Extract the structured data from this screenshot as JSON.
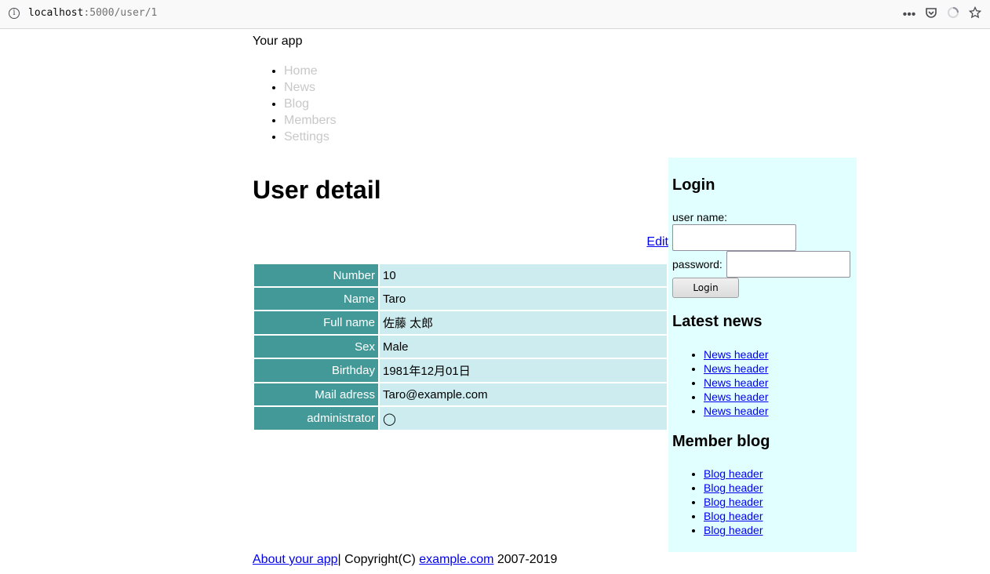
{
  "browser": {
    "host": "localhost",
    "path": ":5000/user/1",
    "icons": [
      "more-icon",
      "pocket-icon",
      "loading-icon",
      "bookmark-star-icon"
    ]
  },
  "brand": "Your app",
  "nav": [
    "Home",
    "News",
    "Blog",
    "Members",
    "Settings"
  ],
  "main": {
    "title": "User detail",
    "edit_label": "Edit",
    "rows": [
      {
        "label": "Number",
        "value": "10"
      },
      {
        "label": "Name",
        "value": "Taro"
      },
      {
        "label": "Full name",
        "value": "佐藤 太郎"
      },
      {
        "label": "Sex",
        "value": "Male"
      },
      {
        "label": "Birthday",
        "value": "1981年12月01日"
      },
      {
        "label": "Mail adress",
        "value": "Taro@example.com"
      },
      {
        "label": "administrator",
        "value": "◯"
      }
    ]
  },
  "sidebar": {
    "login_title": "Login",
    "username_label": "user name:",
    "password_label": "password:",
    "login_button": "Login",
    "news_title": "Latest news",
    "news_items": [
      "News header",
      "News header",
      "News header",
      "News header",
      "News header"
    ],
    "blog_title": "Member blog",
    "blog_items": [
      "Blog header",
      "Blog header",
      "Blog header",
      "Blog header",
      "Blog header"
    ]
  },
  "footer": {
    "about_link": "About your app",
    "copyright_text": "| Copyright(C) ",
    "site_link": "example.com",
    "years": " 2007-2019"
  },
  "colors": {
    "header_cell": "#439898",
    "value_cell": "#ccecef",
    "sidebar_bg": "#e1ffff",
    "link": "#0000ee",
    "nav_text": "#c8c8c8"
  }
}
